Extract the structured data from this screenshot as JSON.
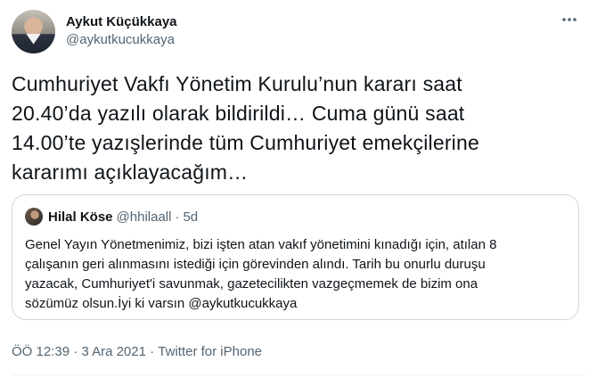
{
  "author": {
    "display_name": "Aykut Küçükkaya",
    "handle": "@aykutkucukkaya"
  },
  "more_icon": "more-horizontal-icon",
  "tweet_text": "Cumhuriyet Vakfı Yönetim Kurulu’nun kararı saat\n20.40’da yazılı olarak bildirildi… Cuma günü saat\n14.00’te yazışlerinde tüm Cumhuriyet emekçilerine\nkararımı açıklayacağım…",
  "quoted_tweet": {
    "display_name": "Hilal Köse",
    "handle": "@hhilaall",
    "separator": "·",
    "time": "5d",
    "text": "Genel Yayın Yönetmenimiz, bizi işten atan vakıf yönetimini kınadığı için, atılan 8\nçalışanın geri alınmasını istediği için görevinden alındı. Tarih bu onurlu duruşu\nyazacak, Cumhuriyet'i savunmak, gazetecilikten vazgeçmemek de bizim ona\nsözümüz olsun.İyi ki varsın @aykutkucukkaya"
  },
  "meta": {
    "time": "ÖÖ 12:39",
    "sep1": " · ",
    "date": "3 Ara 2021",
    "sep2": " · ",
    "source": "Twitter for iPhone"
  }
}
